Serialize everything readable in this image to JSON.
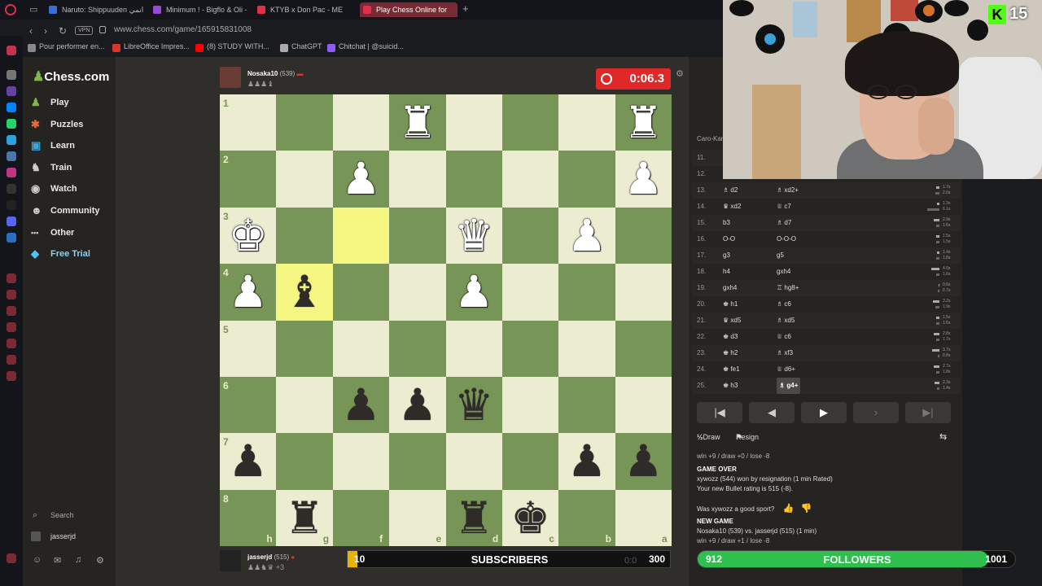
{
  "browser": {
    "tabs": [
      {
        "label": "Naruto: Shippuuden انمي",
        "color": "#3a6fd8"
      },
      {
        "label": "Minimum ! - Bigflo & Oli -",
        "color": "#9b4ad6"
      },
      {
        "label": "KTYB x Don Pac - ME",
        "color": "#e0304a"
      },
      {
        "label": "Play Chess Online for",
        "color": "#e0304a"
      }
    ],
    "url": "www.chess.com/game/165915831008",
    "vpn": "VPN",
    "bookmarks": [
      {
        "label": "Pour performer en...",
        "color": "#888"
      },
      {
        "label": "LibreOffice Impres...",
        "color": "#d8362b"
      },
      {
        "label": "(8) STUDY WITH...",
        "color": "#ff0000"
      },
      {
        "label": "ChatGPT",
        "color": "#aaa"
      },
      {
        "label": "Chitchat | @suicid...",
        "color": "#8b5cf6"
      }
    ]
  },
  "nav": {
    "logo": "Chess.com",
    "items": [
      {
        "label": "Play",
        "icon": "play-icon",
        "glyph": "♟"
      },
      {
        "label": "Puzzles",
        "icon": "puzzle-icon",
        "glyph": "✱"
      },
      {
        "label": "Learn",
        "icon": "learn-icon",
        "glyph": "▣"
      },
      {
        "label": "Train",
        "icon": "train-icon",
        "glyph": "♞"
      },
      {
        "label": "Watch",
        "icon": "watch-icon",
        "glyph": "◉"
      },
      {
        "label": "Community",
        "icon": "community-icon",
        "glyph": "☻"
      },
      {
        "label": "Other",
        "icon": "more-icon",
        "glyph": "•••"
      },
      {
        "label": "Free Trial",
        "icon": "diamond-icon",
        "glyph": "◆"
      }
    ],
    "search": "Search",
    "username": "jasserjd"
  },
  "top_player": {
    "name": "Nosaka10",
    "rating": "(539)",
    "clock": "0:06.3"
  },
  "bottom_player": {
    "name": "jasserjd",
    "rating": "(515)",
    "extra": "+3"
  },
  "board": {
    "ranks": [
      "1",
      "2",
      "3",
      "4",
      "5",
      "6",
      "7",
      "8"
    ],
    "files": [
      "h",
      "g",
      "f",
      "e",
      "d",
      "c",
      "b",
      "a"
    ],
    "highlight": [
      [
        2,
        2
      ],
      [
        3,
        1
      ]
    ],
    "pieces": [
      {
        "r": 0,
        "c": 3,
        "g": "♜",
        "w": true
      },
      {
        "r": 0,
        "c": 7,
        "g": "♜",
        "w": true
      },
      {
        "r": 1,
        "c": 2,
        "g": "♟",
        "w": true
      },
      {
        "r": 1,
        "c": 7,
        "g": "♟",
        "w": true
      },
      {
        "r": 2,
        "c": 0,
        "g": "♚",
        "w": true
      },
      {
        "r": 2,
        "c": 4,
        "g": "♛",
        "w": true
      },
      {
        "r": 2,
        "c": 6,
        "g": "♟",
        "w": true
      },
      {
        "r": 3,
        "c": 0,
        "g": "♟",
        "w": true
      },
      {
        "r": 3,
        "c": 1,
        "g": "♝",
        "w": false
      },
      {
        "r": 3,
        "c": 4,
        "g": "♟",
        "w": true
      },
      {
        "r": 5,
        "c": 2,
        "g": "♟",
        "w": false
      },
      {
        "r": 5,
        "c": 3,
        "g": "♟",
        "w": false
      },
      {
        "r": 5,
        "c": 4,
        "g": "♛",
        "w": false
      },
      {
        "r": 6,
        "c": 0,
        "g": "♟",
        "w": false
      },
      {
        "r": 6,
        "c": 6,
        "g": "♟",
        "w": false
      },
      {
        "r": 6,
        "c": 7,
        "g": "♟",
        "w": false
      },
      {
        "r": 7,
        "c": 1,
        "g": "♜",
        "w": false
      },
      {
        "r": 7,
        "c": 4,
        "g": "♜",
        "w": false
      },
      {
        "r": 7,
        "c": 5,
        "g": "♚",
        "w": false
      }
    ]
  },
  "subscribers": {
    "current": "10",
    "label": "SUBSCRIBERS",
    "goal": "300",
    "progress": 0.03,
    "clock": "0:0"
  },
  "followers": {
    "current": "912",
    "label": "FOLLOWERS",
    "goal": "1001",
    "progress": 0.91
  },
  "kick": {
    "count": "15"
  },
  "opening": "Caro-Kann",
  "moves": [
    {
      "n": "11.",
      "w": "",
      "b": ""
    },
    {
      "n": "12.",
      "w": "",
      "b": ""
    },
    {
      "n": "13.",
      "w": "♗ d2",
      "b": "♗ xd2+",
      "t": [
        "1.7s",
        "2.0s"
      ]
    },
    {
      "n": "14.",
      "w": "♛ xd2",
      "b": "♕ c7",
      "t": [
        "1.3s",
        "6.1s"
      ]
    },
    {
      "n": "15.",
      "w": "b3",
      "b": "♗ d7",
      "t": [
        "2.9s",
        "1.6s"
      ]
    },
    {
      "n": "16.",
      "w": "O-O",
      "b": "O-O-O",
      "t": [
        "1.5s",
        "1.5s"
      ]
    },
    {
      "n": "17.",
      "w": "g3",
      "b": "g5",
      "t": [
        "1.4s",
        "1.8s"
      ]
    },
    {
      "n": "18.",
      "w": "h4",
      "b": "gxh4",
      "t": [
        "4.0s",
        "1.6s"
      ]
    },
    {
      "n": "19.",
      "w": "gxh4",
      "b": "♖ hg8+",
      "t": [
        "0.6s",
        "0.7s"
      ]
    },
    {
      "n": "20.",
      "w": "♚ h1",
      "b": "♗ c6",
      "t": [
        "3.2s",
        "1.9s"
      ]
    },
    {
      "n": "21.",
      "w": "♛ xd5",
      "b": "♗ xd5",
      "t": [
        "1.5s",
        "1.6s"
      ]
    },
    {
      "n": "22.",
      "w": "♚ d3",
      "b": "♕ c6",
      "t": [
        "2.8s",
        "1.7s"
      ]
    },
    {
      "n": "23.",
      "w": "♚ h2",
      "b": "♗ xf3",
      "t": [
        "3.7s",
        "0.8s"
      ]
    },
    {
      "n": "24.",
      "w": "♚ fe1",
      "b": "♕ d6+",
      "t": [
        "2.7s",
        "1.8s"
      ]
    },
    {
      "n": "25.",
      "w": "♚ h3",
      "b": "♗ g4+",
      "t": [
        "2.3s",
        "1.4s"
      ]
    }
  ],
  "actions": {
    "draw": "Draw",
    "draw_glyph": "½",
    "resign": "Resign"
  },
  "info": {
    "line1": "win +9 / draw +0 / lose -8",
    "game_over": "GAME OVER",
    "result": "xywozz (544) won by resignation (1 min Rated)",
    "rating_line": "Your new Bullet rating is 515 (-8).",
    "sport": "Was xywozz a good sport?",
    "new_game": "NEW GAME",
    "matchup": "Nosaka10 (539) vs. jasserjd (515) (1 min)",
    "line2": "win +9 / draw +1 / lose -8"
  }
}
